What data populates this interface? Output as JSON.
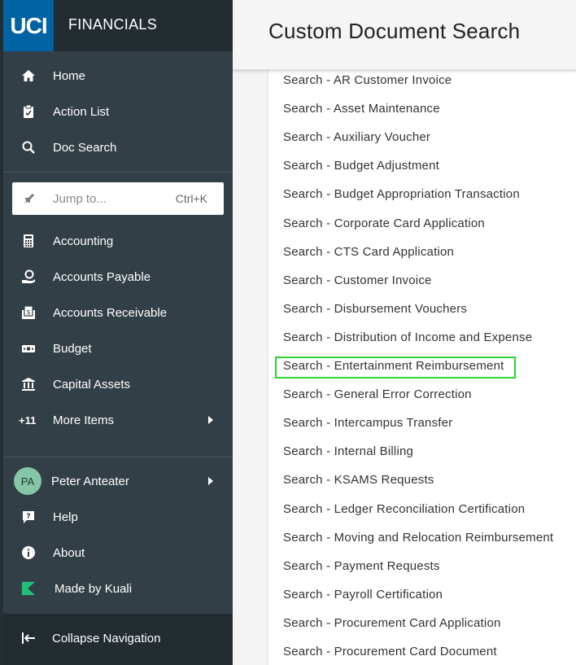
{
  "brand": {
    "logo": "UCI",
    "title": "FINANCIALS"
  },
  "nav_top": [
    {
      "label": "Home",
      "icon": "home-icon"
    },
    {
      "label": "Action List",
      "icon": "clipboard-icon"
    },
    {
      "label": "Doc Search",
      "icon": "search-icon"
    }
  ],
  "jump": {
    "placeholder": "Jump to...",
    "shortcut": "Ctrl+K"
  },
  "nav_modules": [
    {
      "label": "Accounting",
      "icon": "calculator-icon"
    },
    {
      "label": "Accounts Payable",
      "icon": "hand-coin-icon"
    },
    {
      "label": "Accounts Receivable",
      "icon": "receipt-icon"
    },
    {
      "label": "Budget",
      "icon": "money-icon"
    },
    {
      "label": "Capital Assets",
      "icon": "bank-icon"
    },
    {
      "label": "More Items",
      "prefix": "+11"
    }
  ],
  "user": {
    "initials": "PA",
    "name": "Peter Anteater"
  },
  "nav_bottom": [
    {
      "label": "Help",
      "icon": "help-icon"
    },
    {
      "label": "About",
      "icon": "info-icon"
    },
    {
      "label": "Made by Kuali",
      "icon": "kuali-logo-icon"
    }
  ],
  "collapse": {
    "label": "Collapse Navigation"
  },
  "page": {
    "title": "Custom Document Search"
  },
  "doc_links": [
    "Search - AR Customer Invoice",
    "Search - Asset Maintenance",
    "Search - Auxiliary Voucher",
    "Search - Budget Adjustment",
    "Search - Budget Appropriation Transaction",
    "Search - Corporate Card Application",
    "Search - CTS Card Application",
    "Search - Customer Invoice",
    "Search - Disbursement Vouchers",
    "Search - Distribution of Income and Expense",
    "Search - Entertainment Reimbursement",
    "Search - General Error Correction",
    "Search - Intercampus Transfer",
    "Search - Internal Billing",
    "Search - KSAMS Requests",
    "Search - Ledger Reconciliation Certification",
    "Search - Moving and Relocation Reimbursement",
    "Search - Payment Requests",
    "Search - Payroll Certification",
    "Search - Procurement Card Application",
    "Search - Procurement Card Document"
  ],
  "highlighted_link": "Search - Entertainment Reimbursement",
  "colors": {
    "sidebar": "#333f46",
    "brand_blue": "#0064a4",
    "highlight": "#2ed52e"
  }
}
